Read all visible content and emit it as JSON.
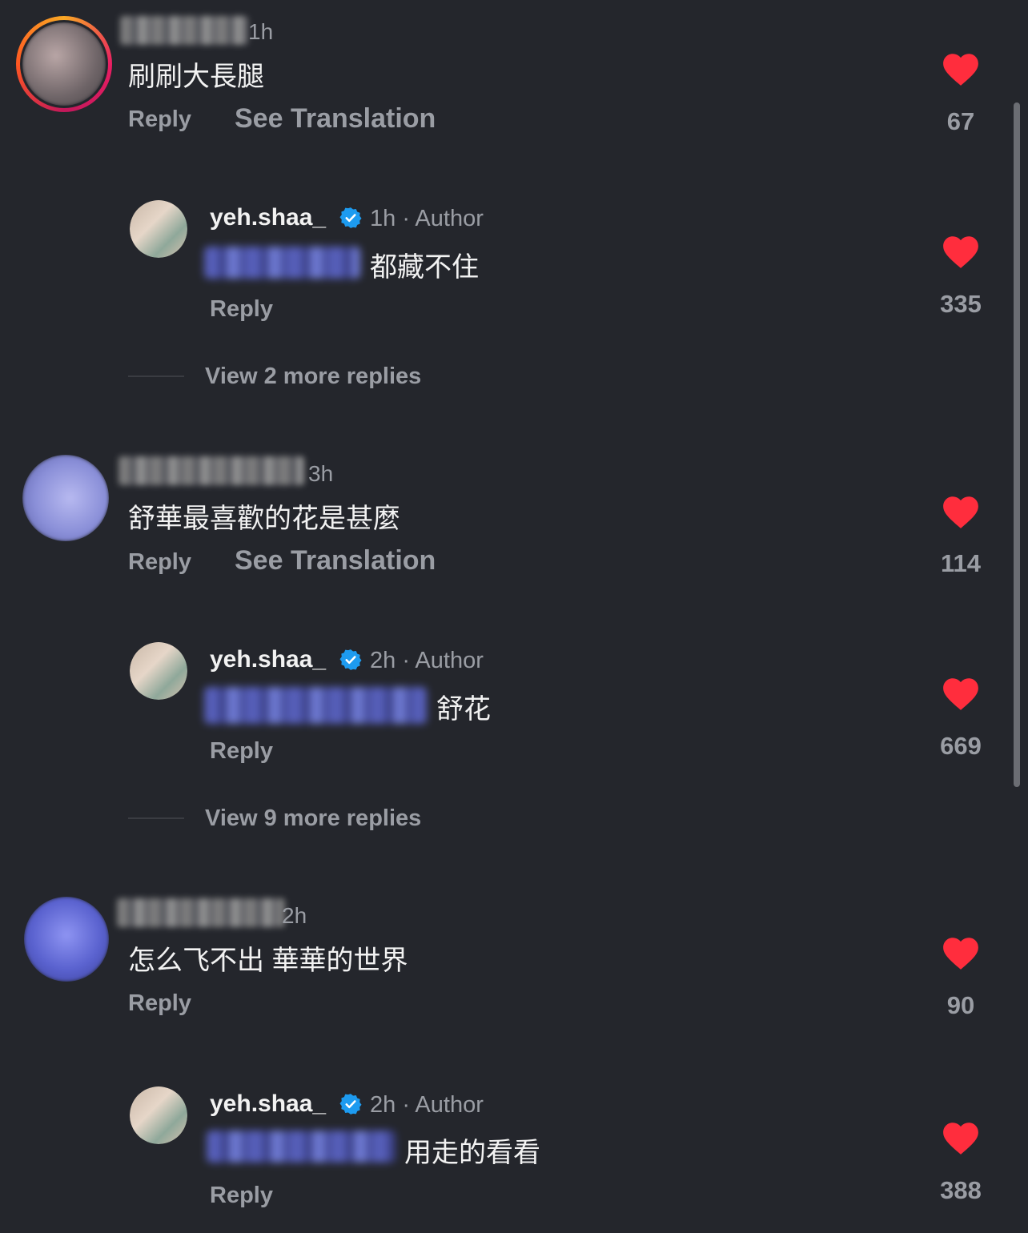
{
  "colors": {
    "background": "#24262c",
    "heart": "#ff2d3d",
    "verified": "#1d9bf0",
    "secondary_text": "#9a9da4"
  },
  "comments": [
    {
      "time": "1h",
      "text": "刷刷大長腿",
      "reply_label": "Reply",
      "translate_label": "See Translation",
      "likes": "67",
      "author_reply": {
        "username": "yeh.shaa_",
        "meta": "1h · Author",
        "text": "都藏不住",
        "reply_label": "Reply",
        "likes": "335"
      },
      "view_more": "View 2 more replies"
    },
    {
      "time": "3h",
      "text": "舒華最喜歡的花是甚麼",
      "reply_label": "Reply",
      "translate_label": "See Translation",
      "likes": "114",
      "author_reply": {
        "username": "yeh.shaa_",
        "meta": "2h · Author",
        "text": "舒花",
        "reply_label": "Reply",
        "likes": "669"
      },
      "view_more": "View 9 more replies"
    },
    {
      "time": "2h",
      "text": "怎么飞不出 華華的世界",
      "reply_label": "Reply",
      "likes": "90",
      "author_reply": {
        "username": "yeh.shaa_",
        "meta": "2h · Author",
        "text": "用走的看看",
        "reply_label": "Reply",
        "likes": "388"
      }
    }
  ],
  "icons": {
    "like": "heart-icon",
    "verified": "verified-badge-icon"
  }
}
